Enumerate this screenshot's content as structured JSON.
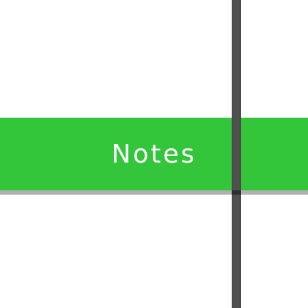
{
  "header": {
    "title": "Notes",
    "background_color": "#33c63a",
    "text_color": "#ffffff"
  },
  "divider": {
    "color": "#4a4a4a"
  }
}
